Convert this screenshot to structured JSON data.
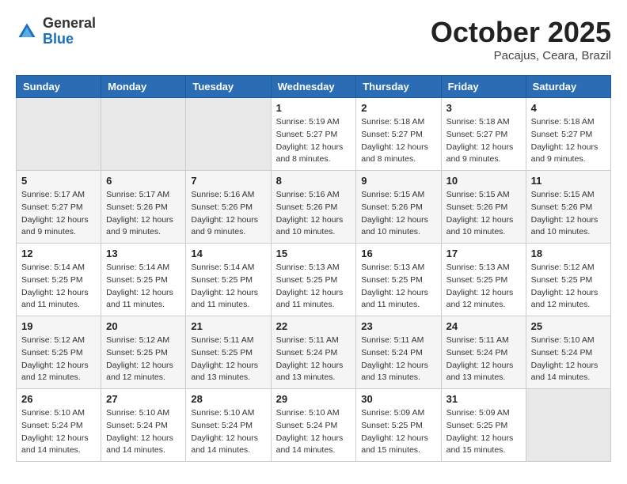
{
  "header": {
    "logo_general": "General",
    "logo_blue": "Blue",
    "month_title": "October 2025",
    "location": "Pacajus, Ceara, Brazil"
  },
  "days_of_week": [
    "Sunday",
    "Monday",
    "Tuesday",
    "Wednesday",
    "Thursday",
    "Friday",
    "Saturday"
  ],
  "weeks": [
    [
      {
        "day": "",
        "info": ""
      },
      {
        "day": "",
        "info": ""
      },
      {
        "day": "",
        "info": ""
      },
      {
        "day": "1",
        "info": "Sunrise: 5:19 AM\nSunset: 5:27 PM\nDaylight: 12 hours\nand 8 minutes."
      },
      {
        "day": "2",
        "info": "Sunrise: 5:18 AM\nSunset: 5:27 PM\nDaylight: 12 hours\nand 8 minutes."
      },
      {
        "day": "3",
        "info": "Sunrise: 5:18 AM\nSunset: 5:27 PM\nDaylight: 12 hours\nand 9 minutes."
      },
      {
        "day": "4",
        "info": "Sunrise: 5:18 AM\nSunset: 5:27 PM\nDaylight: 12 hours\nand 9 minutes."
      }
    ],
    [
      {
        "day": "5",
        "info": "Sunrise: 5:17 AM\nSunset: 5:27 PM\nDaylight: 12 hours\nand 9 minutes."
      },
      {
        "day": "6",
        "info": "Sunrise: 5:17 AM\nSunset: 5:26 PM\nDaylight: 12 hours\nand 9 minutes."
      },
      {
        "day": "7",
        "info": "Sunrise: 5:16 AM\nSunset: 5:26 PM\nDaylight: 12 hours\nand 9 minutes."
      },
      {
        "day": "8",
        "info": "Sunrise: 5:16 AM\nSunset: 5:26 PM\nDaylight: 12 hours\nand 10 minutes."
      },
      {
        "day": "9",
        "info": "Sunrise: 5:15 AM\nSunset: 5:26 PM\nDaylight: 12 hours\nand 10 minutes."
      },
      {
        "day": "10",
        "info": "Sunrise: 5:15 AM\nSunset: 5:26 PM\nDaylight: 12 hours\nand 10 minutes."
      },
      {
        "day": "11",
        "info": "Sunrise: 5:15 AM\nSunset: 5:26 PM\nDaylight: 12 hours\nand 10 minutes."
      }
    ],
    [
      {
        "day": "12",
        "info": "Sunrise: 5:14 AM\nSunset: 5:25 PM\nDaylight: 12 hours\nand 11 minutes."
      },
      {
        "day": "13",
        "info": "Sunrise: 5:14 AM\nSunset: 5:25 PM\nDaylight: 12 hours\nand 11 minutes."
      },
      {
        "day": "14",
        "info": "Sunrise: 5:14 AM\nSunset: 5:25 PM\nDaylight: 12 hours\nand 11 minutes."
      },
      {
        "day": "15",
        "info": "Sunrise: 5:13 AM\nSunset: 5:25 PM\nDaylight: 12 hours\nand 11 minutes."
      },
      {
        "day": "16",
        "info": "Sunrise: 5:13 AM\nSunset: 5:25 PM\nDaylight: 12 hours\nand 11 minutes."
      },
      {
        "day": "17",
        "info": "Sunrise: 5:13 AM\nSunset: 5:25 PM\nDaylight: 12 hours\nand 12 minutes."
      },
      {
        "day": "18",
        "info": "Sunrise: 5:12 AM\nSunset: 5:25 PM\nDaylight: 12 hours\nand 12 minutes."
      }
    ],
    [
      {
        "day": "19",
        "info": "Sunrise: 5:12 AM\nSunset: 5:25 PM\nDaylight: 12 hours\nand 12 minutes."
      },
      {
        "day": "20",
        "info": "Sunrise: 5:12 AM\nSunset: 5:25 PM\nDaylight: 12 hours\nand 12 minutes."
      },
      {
        "day": "21",
        "info": "Sunrise: 5:11 AM\nSunset: 5:25 PM\nDaylight: 12 hours\nand 13 minutes."
      },
      {
        "day": "22",
        "info": "Sunrise: 5:11 AM\nSunset: 5:24 PM\nDaylight: 12 hours\nand 13 minutes."
      },
      {
        "day": "23",
        "info": "Sunrise: 5:11 AM\nSunset: 5:24 PM\nDaylight: 12 hours\nand 13 minutes."
      },
      {
        "day": "24",
        "info": "Sunrise: 5:11 AM\nSunset: 5:24 PM\nDaylight: 12 hours\nand 13 minutes."
      },
      {
        "day": "25",
        "info": "Sunrise: 5:10 AM\nSunset: 5:24 PM\nDaylight: 12 hours\nand 14 minutes."
      }
    ],
    [
      {
        "day": "26",
        "info": "Sunrise: 5:10 AM\nSunset: 5:24 PM\nDaylight: 12 hours\nand 14 minutes."
      },
      {
        "day": "27",
        "info": "Sunrise: 5:10 AM\nSunset: 5:24 PM\nDaylight: 12 hours\nand 14 minutes."
      },
      {
        "day": "28",
        "info": "Sunrise: 5:10 AM\nSunset: 5:24 PM\nDaylight: 12 hours\nand 14 minutes."
      },
      {
        "day": "29",
        "info": "Sunrise: 5:10 AM\nSunset: 5:24 PM\nDaylight: 12 hours\nand 14 minutes."
      },
      {
        "day": "30",
        "info": "Sunrise: 5:09 AM\nSunset: 5:25 PM\nDaylight: 12 hours\nand 15 minutes."
      },
      {
        "day": "31",
        "info": "Sunrise: 5:09 AM\nSunset: 5:25 PM\nDaylight: 12 hours\nand 15 minutes."
      },
      {
        "day": "",
        "info": ""
      }
    ]
  ]
}
